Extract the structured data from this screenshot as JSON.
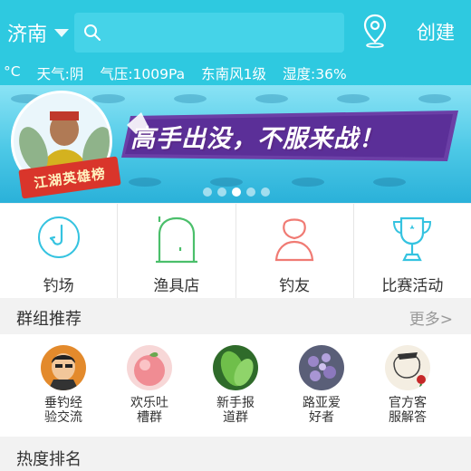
{
  "header": {
    "city": "济南",
    "search_placeholder": "",
    "create_label": "创建"
  },
  "weather": {
    "unit": "°C",
    "condition": "天气:阴",
    "pressure": "气压:1009Pa",
    "wind": "东南风1级",
    "humidity": "湿度:36%"
  },
  "banner": {
    "slogan": "高手出没，不服来战！",
    "ribbon": "江湖英雄榜",
    "dots": 5,
    "active_dot": 3
  },
  "nav": [
    {
      "label": "钓场",
      "icon": "fishhook-icon",
      "color": "#35c3e0"
    },
    {
      "label": "渔具店",
      "icon": "shop-door-icon",
      "color": "#4bbf6b"
    },
    {
      "label": "钓友",
      "icon": "user-icon",
      "color": "#f07a73"
    },
    {
      "label": "比赛活动",
      "icon": "trophy-icon",
      "color": "#35c3e0"
    }
  ],
  "groups_section": {
    "title": "群组推荐",
    "more": "更多>"
  },
  "groups": [
    {
      "line1": "垂钓经",
      "line2": "验交流",
      "avatar": "cartoon-man-avatar"
    },
    {
      "line1": "欢乐吐",
      "line2": "槽群",
      "avatar": "peach-avatar"
    },
    {
      "line1": "新手报",
      "line2": "道群",
      "avatar": "leaf-avatar"
    },
    {
      "line1": "路亚爱",
      "line2": "好者",
      "avatar": "purple-flowers-avatar"
    },
    {
      "line1": "官方客",
      "line2": "服解答",
      "avatar": "sketch-rose-avatar"
    }
  ],
  "ranking_section": {
    "title": "热度排名"
  },
  "colors": {
    "header_bg": "#2ec9e0",
    "accent": "#35c3e0"
  }
}
